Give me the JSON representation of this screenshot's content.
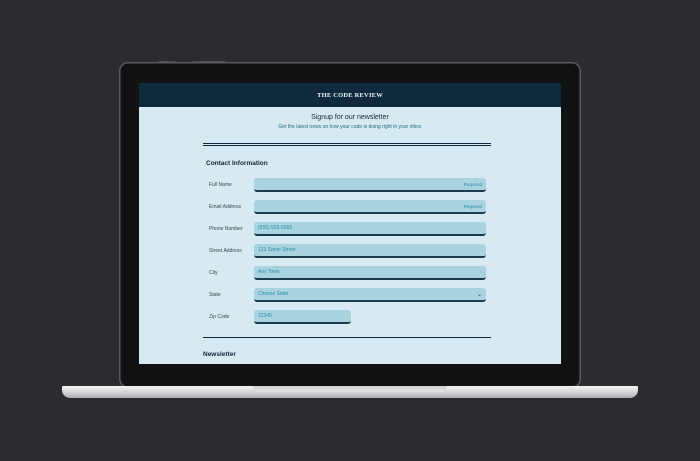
{
  "site": {
    "title": "THE CODE REVIEW"
  },
  "signup": {
    "heading": "Signup for our newsletter",
    "subheading": "Get the latest news on how your code is doing right in your inbox"
  },
  "contact": {
    "section_title": "Contact Information",
    "fields": [
      {
        "label": "Full Name",
        "placeholder": "",
        "tag": "Required"
      },
      {
        "label": "Email Address",
        "placeholder": "",
        "tag": "Required"
      },
      {
        "label": "Phone Number",
        "placeholder": "(555) 555-5555",
        "tag": ""
      },
      {
        "label": "Street Address",
        "placeholder": "123 Some Street",
        "tag": ""
      },
      {
        "label": "City",
        "placeholder": "Any Town",
        "tag": ""
      },
      {
        "label": "State",
        "placeholder": "Choose State",
        "tag": ""
      },
      {
        "label": "Zip Code",
        "placeholder": "12345",
        "tag": ""
      }
    ]
  },
  "newsletter": {
    "section_title": "Newsletter"
  },
  "icons": {
    "state_select": "chevron-down-icon"
  },
  "colors": {
    "header_bg": "#0e2a3c",
    "page_bg": "#d7e9f1",
    "field_bg": "#a9d3df",
    "accent_text": "#2a8ca6"
  }
}
